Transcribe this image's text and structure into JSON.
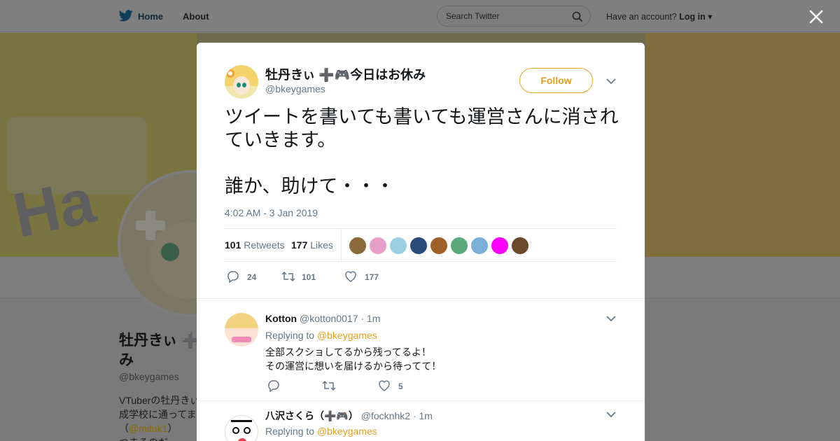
{
  "nav": {
    "home": "Home",
    "about": "About",
    "search_placeholder": "Search Twitter",
    "account_prompt": "Have an account?",
    "login": "Log in"
  },
  "background_profile": {
    "name": "牡丹きぃ ➕\nみ",
    "handle": "@bkeygames",
    "bio_line1": "VTuberの牡丹きぃ",
    "bio_line2": "成学校に通ってま",
    "bio_mention": "@mituk1",
    "bio_line3a": "（",
    "bio_line3b": "）",
    "bio_line4": "つまるのだ"
  },
  "tweet": {
    "author_name": "牡丹きぃ ➕🎮今日はお休み",
    "author_handle": "@bkeygames",
    "follow_label": "Follow",
    "text": "ツイートを書いても書いても運営さんに消されていきます。\n\n誰か、助けて・・・",
    "timestamp": "4:02 AM - 3 Jan 2019",
    "retweets_count": "101",
    "retweets_label": "Retweets",
    "likes_count": "177",
    "likes_label": "Likes",
    "reply_count": "24",
    "retweet_count": "101",
    "like_count": "177",
    "liker_colors": [
      "#8a6a3a",
      "#e8a0c8",
      "#9ad0e0",
      "#2a4a7a",
      "#a0602a",
      "#5aaa7a",
      "#7ab0d8",
      "#ff00ff",
      "#6a4a2a"
    ]
  },
  "replies": [
    {
      "name": "Kotton",
      "handle": "@kotton0017",
      "time": "· 1m",
      "replying_to_label": "Replying to",
      "replying_to": "@bkeygames",
      "text": "全部スクショしてるから残ってるよ！\nその運営に想いを届けるから待ってて！",
      "reply_count": "",
      "retweet_count": "",
      "like_count": "5"
    },
    {
      "name": "八沢さくら（➕🎮）",
      "handle": "@focknhk2",
      "time": "· 1m",
      "replying_to_label": "Replying to",
      "replying_to": "@bkeygames"
    }
  ],
  "colors": {
    "accent": "#e0a020",
    "secondary_text": "#657786",
    "overlay": "#7f7f7f"
  }
}
